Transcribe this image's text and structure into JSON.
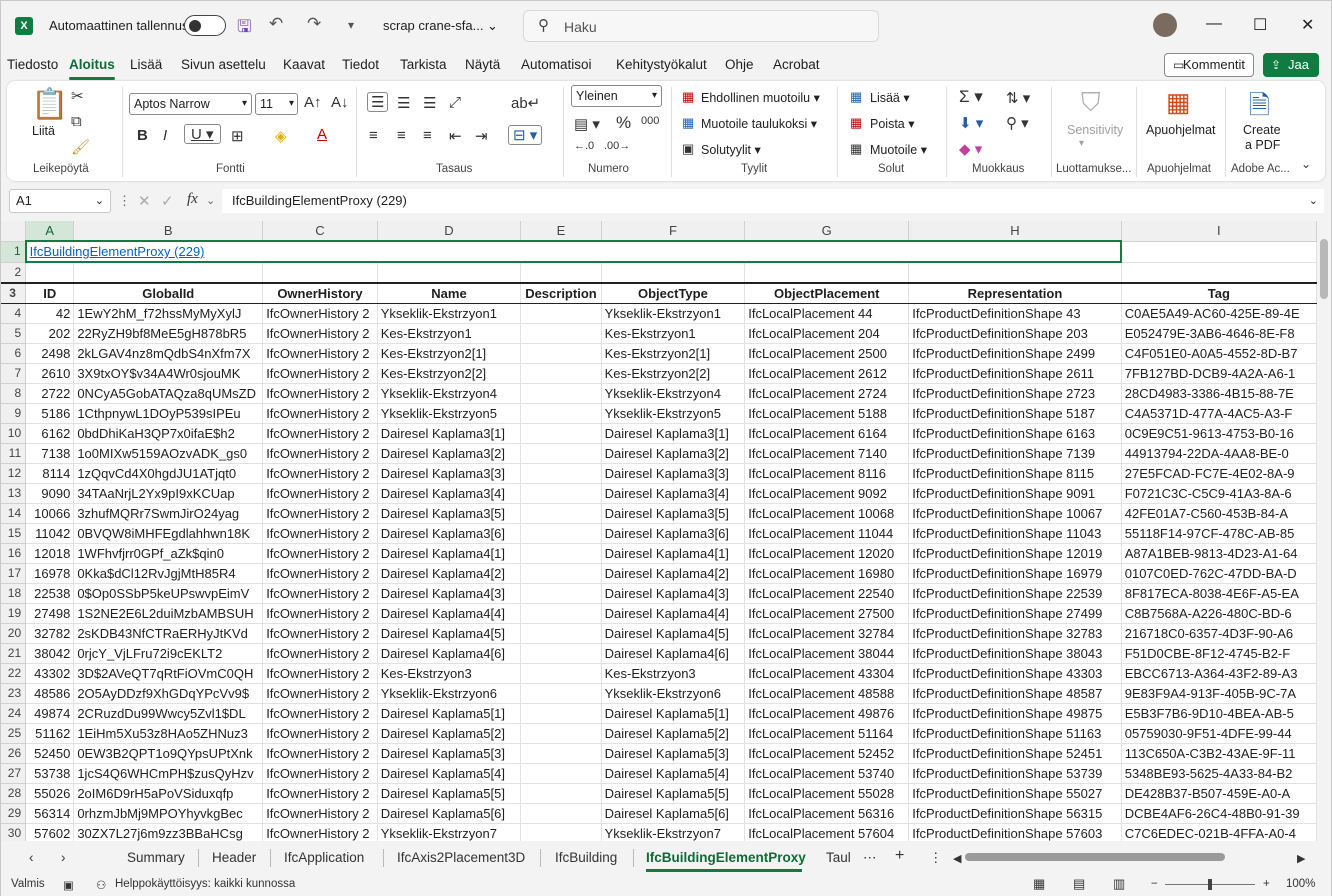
{
  "titlebar": {
    "autosave_label": "Automaattinen tallennus",
    "filename": "scrap crane-sfa...",
    "search_placeholder": "Haku"
  },
  "menu": [
    "Tiedosto",
    "Aloitus",
    "Lisää",
    "Sivun asettelu",
    "Kaavat",
    "Tiedot",
    "Tarkista",
    "Näytä",
    "Automatisoi",
    "Kehitystyökalut",
    "Ohje",
    "Acrobat"
  ],
  "menu_active": "Aloitus",
  "comments_label": "Kommentit",
  "share_label": "Jaa",
  "ribbon": {
    "paste_label": "Liitä",
    "font_name": "Aptos Narrow",
    "font_size": "11",
    "number_format": "Yleinen",
    "conditional_format": "Ehdollinen muotoilu",
    "format_as_table": "Muotoile taulukoksi",
    "cell_styles": "Solutyylit",
    "insert": "Lisää",
    "delete": "Poista",
    "format": "Muotoile",
    "sensitivity": "Sensitivity",
    "addins": "Apuohjelmat",
    "create_pdf_1": "Create",
    "create_pdf_2": "a PDF",
    "groups": {
      "clipboard": "Leikepöytä",
      "font": "Fontti",
      "alignment": "Tasaus",
      "number": "Numero",
      "styles": "Tyylit",
      "cells": "Solut",
      "editing": "Muokkaus",
      "sensitivity": "Luottamukse...",
      "addins": "Apuohjelmat",
      "adobe": "Adobe Ac..."
    }
  },
  "formula": {
    "namebox": "A1",
    "content": "IfcBuildingElementProxy  (229)"
  },
  "columns": [
    "A",
    "B",
    "C",
    "D",
    "E",
    "F",
    "G",
    "H",
    "I"
  ],
  "title_cell": "IfcBuildingElementProxy  (229)",
  "headers": [
    "ID",
    "GlobalId",
    "OwnerHistory",
    "Name",
    "Description",
    "ObjectType",
    "ObjectPlacement",
    "Representation",
    "Tag"
  ],
  "rows": [
    [
      "42",
      "1EwY2hM_f72hssMyMyXylJ",
      "IfcOwnerHistory 2",
      "Ykseklik-Ekstrzyon1",
      "",
      "Ykseklik-Ekstrzyon1",
      "IfcLocalPlacement 44",
      "IfcProductDefinitionShape 43",
      "C0AE5A49-AC60-425E-89-4E"
    ],
    [
      "202",
      "22RyZH9bf8MeE5gH878bR5",
      "IfcOwnerHistory 2",
      "Kes-Ekstrzyon1",
      "",
      "Kes-Ekstrzyon1",
      "IfcLocalPlacement 204",
      "IfcProductDefinitionShape 203",
      "E052479E-3AB6-4646-8E-F8"
    ],
    [
      "2498",
      "2kLGAV4nz8mQdbS4nXfm7X",
      "IfcOwnerHistory 2",
      "Kes-Ekstrzyon2[1]",
      "",
      "Kes-Ekstrzyon2[1]",
      "IfcLocalPlacement 2500",
      "IfcProductDefinitionShape 2499",
      "C4F051E0-A0A5-4552-8D-B7"
    ],
    [
      "2610",
      "3X9txOY$v34A4Wr0sjouMK",
      "IfcOwnerHistory 2",
      "Kes-Ekstrzyon2[2]",
      "",
      "Kes-Ekstrzyon2[2]",
      "IfcLocalPlacement 2612",
      "IfcProductDefinitionShape 2611",
      "7FB127BD-DCB9-4A2A-A6-1"
    ],
    [
      "2722",
      "0NCyA5GobATAQza8qUMsZD",
      "IfcOwnerHistory 2",
      "Ykseklik-Ekstrzyon4",
      "",
      "Ykseklik-Ekstrzyon4",
      "IfcLocalPlacement 2724",
      "IfcProductDefinitionShape 2723",
      "28CD4983-3386-4B15-88-7E"
    ],
    [
      "5186",
      "1CthpnywL1DOyP539sIPEu",
      "IfcOwnerHistory 2",
      "Ykseklik-Ekstrzyon5",
      "",
      "Ykseklik-Ekstrzyon5",
      "IfcLocalPlacement 5188",
      "IfcProductDefinitionShape 5187",
      "C4A5371D-477A-4AC5-A3-F"
    ],
    [
      "6162",
      "0bdDhiKaH3QP7x0ifaE$h2",
      "IfcOwnerHistory 2",
      "Dairesel Kaplama3[1]",
      "",
      "Dairesel Kaplama3[1]",
      "IfcLocalPlacement 6164",
      "IfcProductDefinitionShape 6163",
      "0C9E9C51-9613-4753-B0-16"
    ],
    [
      "7138",
      "1o0MIXw5159AOzvADK_gs0",
      "IfcOwnerHistory 2",
      "Dairesel Kaplama3[2]",
      "",
      "Dairesel Kaplama3[2]",
      "IfcLocalPlacement 7140",
      "IfcProductDefinitionShape 7139",
      "44913794-22DA-4AA8-BE-0"
    ],
    [
      "8114",
      "1zQqvCd4X0hgdJU1ATjqt0",
      "IfcOwnerHistory 2",
      "Dairesel Kaplama3[3]",
      "",
      "Dairesel Kaplama3[3]",
      "IfcLocalPlacement 8116",
      "IfcProductDefinitionShape 8115",
      "27E5FCAD-FC7E-4E02-8A-9"
    ],
    [
      "9090",
      "34TAaNrjL2Yx9pI9xKCUap",
      "IfcOwnerHistory 2",
      "Dairesel Kaplama3[4]",
      "",
      "Dairesel Kaplama3[4]",
      "IfcLocalPlacement 9092",
      "IfcProductDefinitionShape 9091",
      "F0721C3C-C5C9-41A3-8A-6"
    ],
    [
      "10066",
      "3zhufMQRr7SwmJirO24yag",
      "IfcOwnerHistory 2",
      "Dairesel Kaplama3[5]",
      "",
      "Dairesel Kaplama3[5]",
      "IfcLocalPlacement 10068",
      "IfcProductDefinitionShape 10067",
      "42FE01A7-C560-453B-84-A"
    ],
    [
      "11042",
      "0BVQW8iMHFEgdlahhwn18K",
      "IfcOwnerHistory 2",
      "Dairesel Kaplama3[6]",
      "",
      "Dairesel Kaplama3[6]",
      "IfcLocalPlacement 11044",
      "IfcProductDefinitionShape 11043",
      "55118F14-97CF-478C-AB-85"
    ],
    [
      "12018",
      "1WFhvfjrr0GPf_aZk$qin0",
      "IfcOwnerHistory 2",
      "Dairesel Kaplama4[1]",
      "",
      "Dairesel Kaplama4[1]",
      "IfcLocalPlacement 12020",
      "IfcProductDefinitionShape 12019",
      "A87A1BEB-9813-4D23-A1-64"
    ],
    [
      "16978",
      "0Kka$dCl12RvJgjMtH85R4",
      "IfcOwnerHistory 2",
      "Dairesel Kaplama4[2]",
      "",
      "Dairesel Kaplama4[2]",
      "IfcLocalPlacement 16980",
      "IfcProductDefinitionShape 16979",
      "0107C0ED-762C-47DD-BA-D"
    ],
    [
      "22538",
      "0$Op0SSbP5keUPswvpEimV",
      "IfcOwnerHistory 2",
      "Dairesel Kaplama4[3]",
      "",
      "Dairesel Kaplama4[3]",
      "IfcLocalPlacement 22540",
      "IfcProductDefinitionShape 22539",
      "8F817ECA-8038-4E6F-A5-EA"
    ],
    [
      "27498",
      "1S2NE2E6L2duiMzbAMBSUH",
      "IfcOwnerHistory 2",
      "Dairesel Kaplama4[4]",
      "",
      "Dairesel Kaplama4[4]",
      "IfcLocalPlacement 27500",
      "IfcProductDefinitionShape 27499",
      "C8B7568A-A226-480C-BD-6"
    ],
    [
      "32782",
      "2sKDB43NfCTRaERHyJtKVd",
      "IfcOwnerHistory 2",
      "Dairesel Kaplama4[5]",
      "",
      "Dairesel Kaplama4[5]",
      "IfcLocalPlacement 32784",
      "IfcProductDefinitionShape 32783",
      "216718C0-6357-4D3F-90-A6"
    ],
    [
      "38042",
      "0rjcY_VjLFru72i9cEKLT2",
      "IfcOwnerHistory 2",
      "Dairesel Kaplama4[6]",
      "",
      "Dairesel Kaplama4[6]",
      "IfcLocalPlacement 38044",
      "IfcProductDefinitionShape 38043",
      "F51D0CBE-8F12-4745-B2-F"
    ],
    [
      "43302",
      "3D$2AVeQT7qRtFiOVmC0QH",
      "IfcOwnerHistory 2",
      "Kes-Ekstrzyon3",
      "",
      "Kes-Ekstrzyon3",
      "IfcLocalPlacement 43304",
      "IfcProductDefinitionShape 43303",
      "EBCC6713-A364-43F2-89-A3"
    ],
    [
      "48586",
      "2O5AyDDzf9XhGDqYPcVv9$",
      "IfcOwnerHistory 2",
      "Ykseklik-Ekstrzyon6",
      "",
      "Ykseklik-Ekstrzyon6",
      "IfcLocalPlacement 48588",
      "IfcProductDefinitionShape 48587",
      "9E83F9A4-913F-405B-9C-7A"
    ],
    [
      "49874",
      "2CRuzdDu99Wwcy5Zvl1$DL",
      "IfcOwnerHistory 2",
      "Dairesel Kaplama5[1]",
      "",
      "Dairesel Kaplama5[1]",
      "IfcLocalPlacement 49876",
      "IfcProductDefinitionShape 49875",
      "E5B3F7B6-9D10-4BEA-AB-5"
    ],
    [
      "51162",
      "1EiHm5Xu53z8HAo5ZHNuz3",
      "IfcOwnerHistory 2",
      "Dairesel Kaplama5[2]",
      "",
      "Dairesel Kaplama5[2]",
      "IfcLocalPlacement 51164",
      "IfcProductDefinitionShape 51163",
      "05759030-9F51-4DFE-99-44"
    ],
    [
      "52450",
      "0EW3B2QPT1o9QYpsUPtXnk",
      "IfcOwnerHistory 2",
      "Dairesel Kaplama5[3]",
      "",
      "Dairesel Kaplama5[3]",
      "IfcLocalPlacement 52452",
      "IfcProductDefinitionShape 52451",
      "113C650A-C3B2-43AE-9F-11"
    ],
    [
      "53738",
      "1jcS4Q6WHCmPH$zusQyHzv",
      "IfcOwnerHistory 2",
      "Dairesel Kaplama5[4]",
      "",
      "Dairesel Kaplama5[4]",
      "IfcLocalPlacement 53740",
      "IfcProductDefinitionShape 53739",
      "5348BE93-5625-4A33-84-B2"
    ],
    [
      "55026",
      "2oIM6D9rH5aPoVSiduxqfp",
      "IfcOwnerHistory 2",
      "Dairesel Kaplama5[5]",
      "",
      "Dairesel Kaplama5[5]",
      "IfcLocalPlacement 55028",
      "IfcProductDefinitionShape 55027",
      "DE428B37-B507-459E-A0-A"
    ],
    [
      "56314",
      "0rhzmJbMj9MPOYhyvkgBec",
      "IfcOwnerHistory 2",
      "Dairesel Kaplama5[6]",
      "",
      "Dairesel Kaplama5[6]",
      "IfcLocalPlacement 56316",
      "IfcProductDefinitionShape 56315",
      "DCBE4AF6-26C4-48B0-91-39"
    ],
    [
      "57602",
      "30ZX7L27j6m9zz3BBaHCsg",
      "IfcOwnerHistory 2",
      "Ykseklik-Ekstrzyon7",
      "",
      "Ykseklik-Ekstrzyon7",
      "IfcLocalPlacement 57604",
      "IfcProductDefinitionShape 57603",
      "C7C6EDEC-021B-4FFA-A0-4"
    ]
  ],
  "sheets": [
    "Summary",
    "Header",
    "IfcApplication",
    "IfcAxis2Placement3D",
    "IfcBuilding",
    "IfcBuildingElementProxy",
    "Taul"
  ],
  "status": {
    "ready": "Valmis",
    "accessibility": "Helppokäyttöisyys: kaikki kunnossa",
    "zoom": "100%"
  }
}
